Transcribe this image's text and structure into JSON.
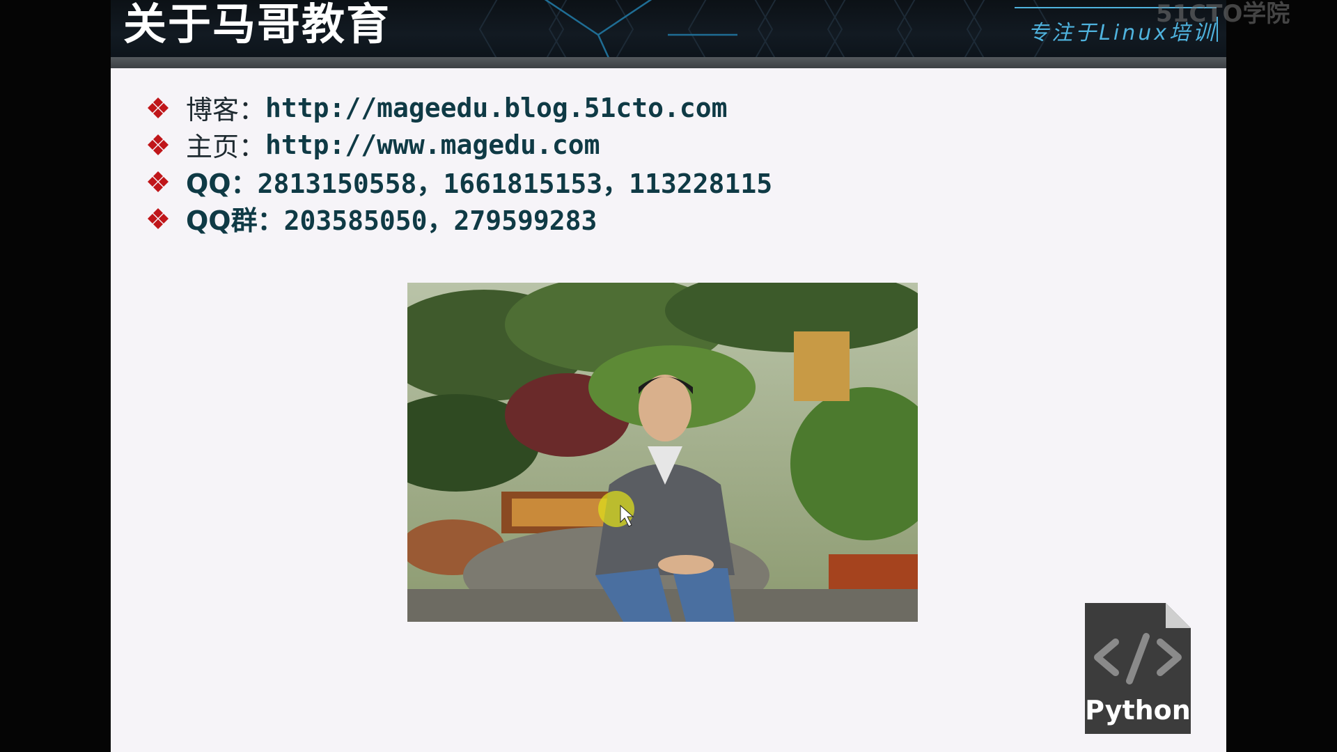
{
  "slide": {
    "title": "关于马哥教育",
    "tagline": "专注于Linux培训",
    "watermark": "51CTO学院"
  },
  "info_list": [
    {
      "label": "博客：",
      "value": "http://mageedu.blog.51cto.com"
    },
    {
      "label": "主页：",
      "value": "http://www.magedu.com"
    },
    {
      "label": "QQ：",
      "value": "2813150558，1661815153，113228115"
    },
    {
      "label": "QQ群：",
      "value": "203585050，279599283"
    }
  ],
  "badge": {
    "icon": "code-brackets-icon",
    "label": "Python"
  },
  "colors": {
    "bullet": "#c0161a",
    "title": "#ffffff",
    "tagline": "#4fb3de",
    "text": "#0f3a45",
    "slide_background": "#f6f4f8",
    "badge": "#3c3c3c"
  }
}
